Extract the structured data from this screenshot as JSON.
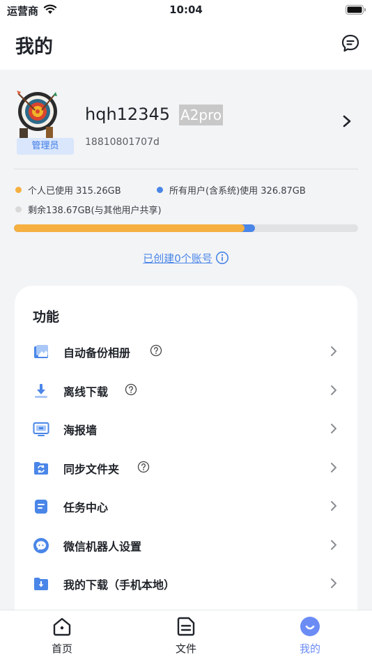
{
  "status_bar": {
    "carrier": "运营商",
    "time": "10:04"
  },
  "header": {
    "title": "我的"
  },
  "profile": {
    "role": "管理员",
    "username": "hqh12345",
    "device": "A2pro",
    "phone": "18810801707d"
  },
  "storage": {
    "personal_label": "个人已使用 315.26GB",
    "all_users_label": "所有用户(含系统)使用 326.87GB",
    "remaining_label": "剩余138.67GB(与其他用户共享)",
    "personal_fraction": 0.67,
    "all_users_fraction": 0.7,
    "personal_color": "#f5b041",
    "all_users_color": "#4a86e8",
    "remaining_color": "#d9d9d9"
  },
  "accounts": {
    "link_text": "已创建0个账号"
  },
  "features": {
    "title": "功能",
    "items": [
      {
        "label": "自动备份相册",
        "icon": "photo-backup-icon",
        "help": true
      },
      {
        "label": "离线下载",
        "icon": "download-icon",
        "help": true
      },
      {
        "label": "海报墙",
        "icon": "poster-wall-icon",
        "help": false
      },
      {
        "label": "同步文件夹",
        "icon": "sync-folder-icon",
        "help": true
      },
      {
        "label": "任务中心",
        "icon": "task-center-icon",
        "help": false
      },
      {
        "label": "微信机器人设置",
        "icon": "wechat-bot-icon",
        "help": false
      },
      {
        "label": "我的下载（手机本地）",
        "icon": "local-download-icon",
        "help": false
      }
    ]
  },
  "tab_bar": {
    "tabs": [
      {
        "label": "首页",
        "icon": "home-icon"
      },
      {
        "label": "文件",
        "icon": "file-icon"
      },
      {
        "label": "我的",
        "icon": "profile-smile-icon"
      }
    ],
    "active_color": "#6b8cf5"
  }
}
